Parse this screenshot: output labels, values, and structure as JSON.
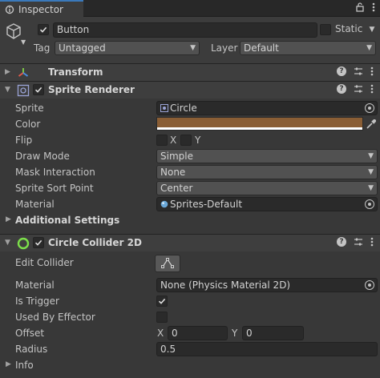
{
  "tab": {
    "title": "Inspector"
  },
  "header": {
    "name": "Button",
    "active": true,
    "static_label": "Static",
    "static": false,
    "tag_label": "Tag",
    "tag_value": "Untagged",
    "layer_label": "Layer",
    "layer_value": "Default"
  },
  "transform": {
    "title": "Transform"
  },
  "sprite_renderer": {
    "title": "Sprite Renderer",
    "enabled": true,
    "sprite_label": "Sprite",
    "sprite_value": "Circle",
    "color_label": "Color",
    "color_value": "#8a5e35",
    "flip_label": "Flip",
    "flip_x_label": "X",
    "flip_y_label": "Y",
    "draw_mode_label": "Draw Mode",
    "draw_mode_value": "Simple",
    "mask_label": "Mask Interaction",
    "mask_value": "None",
    "sort_point_label": "Sprite Sort Point",
    "sort_point_value": "Center",
    "material_label": "Material",
    "material_value": "Sprites-Default",
    "additional_settings": "Additional Settings"
  },
  "circle_collider": {
    "title": "Circle Collider 2D",
    "enabled": true,
    "edit_collider_label": "Edit Collider",
    "material_label": "Material",
    "material_value": "None (Physics Material 2D)",
    "is_trigger_label": "Is Trigger",
    "is_trigger": true,
    "used_by_effector_label": "Used By Effector",
    "used_by_effector": false,
    "offset_label": "Offset",
    "offset_x_label": "X",
    "offset_x": "0",
    "offset_y_label": "Y",
    "offset_y": "0",
    "radius_label": "Radius",
    "radius_value": "0.5",
    "info_label": "Info"
  },
  "icons": [
    "inspector-icon",
    "lock-icon",
    "more-icon",
    "cube-icon",
    "transform-icon",
    "sprite-renderer-icon",
    "circle-collider-icon",
    "help-icon",
    "presets-icon",
    "eyedropper-icon",
    "object-picker-icon",
    "edit-collider-icon"
  ]
}
